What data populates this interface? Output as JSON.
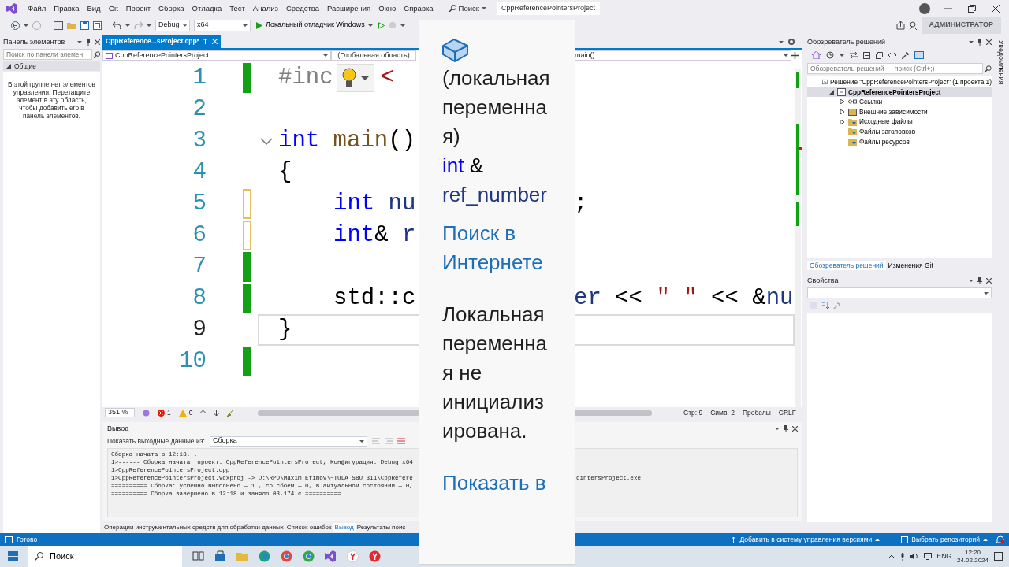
{
  "menu": [
    "Файл",
    "Правка",
    "Вид",
    "Git",
    "Проект",
    "Сборка",
    "Отладка",
    "Тест",
    "Анализ",
    "Средства",
    "Расширения",
    "Окно",
    "Справка"
  ],
  "search_button": "Поиск",
  "title": "CppReferencePointersProject",
  "admin_badge": "АДМИНИСТРАТОР",
  "toolbar": {
    "configuration": "Debug",
    "platform": "x64",
    "run_label": "Локальный отладчик Windows"
  },
  "toolbox": {
    "title": "Панель элементов",
    "placeholder": "Поиск по панели элемен",
    "group": "Общие",
    "group_expanded": true,
    "message": "В этой группе нет элементов управления. Перетащите элемент в эту область, чтобы добавить его в панель элементов."
  },
  "editor": {
    "tabs": [
      {
        "label": "CppReference...sProject.cpp*",
        "selected": true
      }
    ],
    "nav": {
      "project": "CppReferencePointersProject",
      "scope": "(Глобальная область)",
      "member": "main()"
    },
    "lines": [
      {
        "num": "1",
        "changed": true,
        "saved": true,
        "current": false,
        "left": [
          {
            "text": "#inc",
            "kind": "preprocessor"
          },
          {
            "kind": "lightbulb"
          },
          {
            "text": "<",
            "kind": "string"
          }
        ]
      },
      {
        "num": "2",
        "changed": false,
        "current": false
      },
      {
        "num": "3",
        "changed": false,
        "current": false,
        "fold_expanded": true,
        "left": [
          {
            "text": "int",
            "kind": "keyword"
          },
          {
            "text": " main",
            "kind": "function"
          },
          {
            "text": "()",
            "kind": "plain"
          }
        ]
      },
      {
        "num": "4",
        "changed": false,
        "current": false,
        "left": [
          {
            "text": "{",
            "kind": "plain"
          }
        ]
      },
      {
        "num": "5",
        "changed": true,
        "saved": false,
        "current": false,
        "indented": true,
        "left": [
          {
            "text": "int",
            "kind": "keyword"
          },
          {
            "text": " nu",
            "kind": "variable"
          }
        ],
        "right": [
          {
            "text": ";",
            "kind": "plain"
          }
        ]
      },
      {
        "num": "6",
        "changed": true,
        "saved": false,
        "current": false,
        "indented": true,
        "left": [
          {
            "text": "int",
            "kind": "keyword"
          },
          {
            "text": "& ",
            "kind": "plain"
          },
          {
            "text": "r",
            "kind": "variable"
          }
        ]
      },
      {
        "num": "7",
        "changed": true,
        "saved": true,
        "current": false
      },
      {
        "num": "8",
        "changed": true,
        "saved": true,
        "current": false,
        "indented": true,
        "left": [
          {
            "text": "std::c",
            "kind": "plain"
          }
        ],
        "right": [
          {
            "text": "er",
            "kind": "variable"
          },
          {
            "text": " << ",
            "kind": "plain"
          },
          {
            "text": "\" \"",
            "kind": "string"
          },
          {
            "text": " << &",
            "kind": "plain"
          },
          {
            "text": "nu",
            "kind": "variable"
          }
        ]
      },
      {
        "num": "9",
        "changed": false,
        "current": true,
        "left": [
          {
            "text": "}",
            "kind": "plain"
          }
        ]
      },
      {
        "num": "10",
        "changed": true,
        "saved": true,
        "current": false
      }
    ],
    "zoom": "351 %",
    "errors": "1",
    "warnings": "0",
    "line_pos": "Стр: 9",
    "col_pos": "Симв: 2",
    "indent": "Пробелы",
    "eol": "CRLF"
  },
  "quick_info": {
    "symbol_kind": "(локальная переменная)",
    "signature": [
      {
        "text": "int",
        "kind": "keyword"
      },
      {
        "text": " & ",
        "kind": "plain"
      },
      {
        "text": "ref_number",
        "kind": "variable"
      }
    ],
    "search_link": "Поиск в Интернете",
    "message": "Локальная переменная не инициализирована.",
    "show_link": "Показать в"
  },
  "solution_explorer": {
    "title": "Обозреватель решений",
    "placeholder": "Обозреватель решений — поиск (Ctrl+;)",
    "tree": [
      {
        "label": "Решение \"CppReferencePointersProject\" (1 проекта 1)",
        "kind": "solution",
        "selected": false,
        "children": [
          {
            "label": "CppReferencePointersProject",
            "kind": "project",
            "selected": true,
            "expanded": true,
            "children": [
              {
                "label": "Ссылки",
                "kind": "references",
                "selected": false,
                "expanded": false
              },
              {
                "label": "Внешние зависимости",
                "kind": "external",
                "selected": false,
                "expanded": false
              },
              {
                "label": "Исходные файлы",
                "kind": "folder",
                "selected": false,
                "expanded": false
              },
              {
                "label": "Файлы заголовков",
                "kind": "folder",
                "selected": false
              },
              {
                "label": "Файлы ресурсов",
                "kind": "folder",
                "selected": false
              }
            ]
          }
        ]
      }
    ],
    "tabs": [
      {
        "label": "Обозреватель решений",
        "selected": true
      },
      {
        "label": "Изменения Git",
        "selected": false
      }
    ]
  },
  "properties": {
    "title": "Свойства"
  },
  "output": {
    "title": "Вывод",
    "source_label": "Показать выходные данные из:",
    "source": "Сборка",
    "lines": [
      {
        "left": "Сборка начата в 12:18..."
      },
      {
        "left": "1>------ Сборка начата: проект: CppReferencePointersProject, Конфигурация: Debug x64"
      },
      {
        "left": "1>CppReferencePointersProject.cpp"
      },
      {
        "left": "1>CppReferencePointersProject.vcxproj -> D:\\RPO\\Maxim Efimov\\~TULA SBU 311\\CppRefere",
        "right": "ointersProject.exe"
      },
      {
        "left": "========== Сборка: успешно выполнено — 1 , со сбоем — 0, в актуальном состоянии — 0,"
      },
      {
        "left": "========== Сборка завершено в 12:18 и заняло 03,174 с =========="
      }
    ]
  },
  "bottom_tabs": [
    {
      "label": "Операции инструментальных средств для обработки данных",
      "selected": false
    },
    {
      "label": "Список ошибок",
      "selected": false
    },
    {
      "label": "Вывод",
      "selected": true
    },
    {
      "label": "Результаты поис",
      "selected": false
    }
  ],
  "notifications": "Уведомления",
  "status_bar": {
    "ready": "Готово",
    "add_vcs": "Добавить в систему управления версиями",
    "repo": "Выбрать репозиторий"
  },
  "taskbar": {
    "search": "Поиск",
    "lang": "ENG",
    "time": "12:20",
    "date": "24.02.2024"
  }
}
